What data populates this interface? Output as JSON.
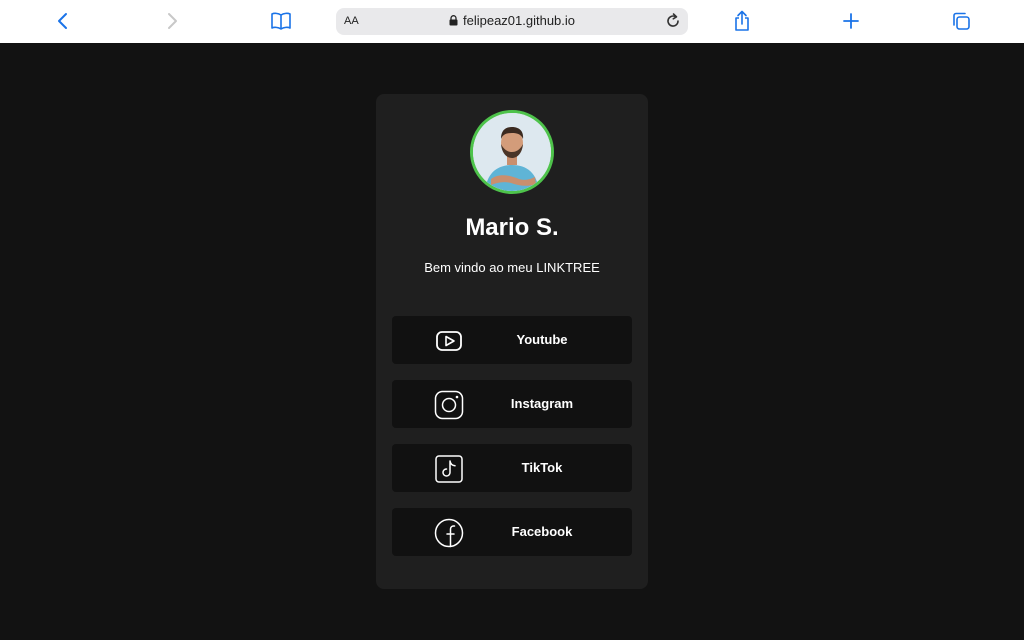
{
  "browser": {
    "aa_label": "AA",
    "url": "felipeaz01.github.io"
  },
  "profile": {
    "name": "Mario S.",
    "subtitle": "Bem vindo ao meu LINKTREE"
  },
  "links": [
    {
      "label": "Youtube",
      "icon": "youtube-icon"
    },
    {
      "label": "Instagram",
      "icon": "instagram-icon"
    },
    {
      "label": "TikTok",
      "icon": "tiktok-icon"
    },
    {
      "label": "Facebook",
      "icon": "facebook-icon"
    }
  ],
  "colors": {
    "page_bg": "#121212",
    "card_bg": "#1f1f1f",
    "button_bg": "#111111",
    "avatar_border": "#4ec34b",
    "browser_accent": "#1a73e8"
  }
}
